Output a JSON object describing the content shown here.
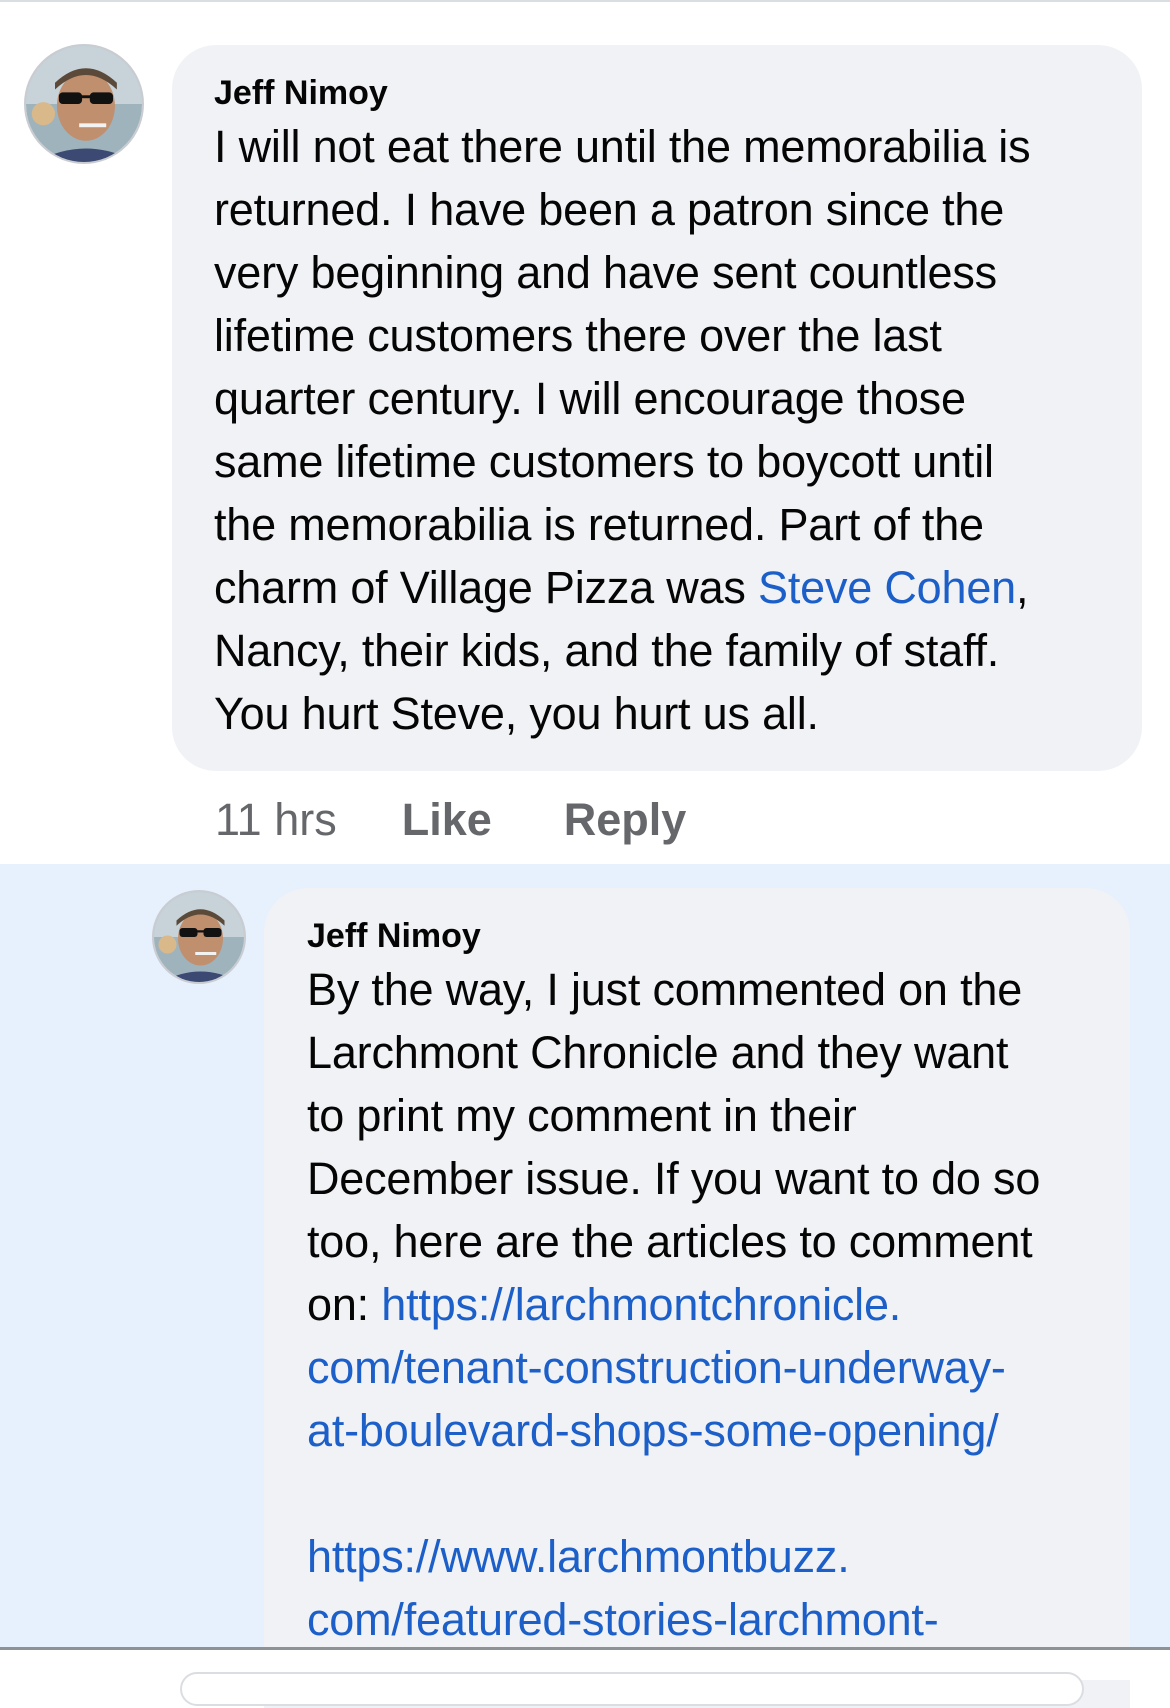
{
  "comment": {
    "author": "Jeff Nimoy",
    "lines": [
      "I will not eat there until the memorabilia is",
      "returned. I have been a patron since the",
      "very beginning and have sent countless",
      "lifetime customers there over the last",
      "quarter century. I will encourage those",
      "same lifetime customers to boycott until",
      "the memorabilia is returned. Part of the"
    ],
    "mention_line_before": "charm of Village Pizza was ",
    "mention": "Steve Cohen",
    "mention_line_after": ",",
    "tail_lines": [
      "Nancy, their kids, and the family of staff.",
      "You hurt Steve, you hurt us all."
    ],
    "time": "11 hrs",
    "like_label": "Like",
    "reply_label": "Reply"
  },
  "reply": {
    "author": "Jeff Nimoy",
    "lines": [
      "By the way, I just commented on  the",
      "Larchmont Chronicle and they want",
      "to print my comment in their",
      "December issue. If you want to do so",
      "too, here are the articles to comment"
    ],
    "link_prefix": "on: ",
    "link1_lines": [
      "https://larchmontchronicle.",
      "com/tenant-construction-underway-",
      "at-boulevard-shops-some-opening/"
    ],
    "link2_lines": [
      "https://www.larchmontbuzz.",
      "com/featured-stories-larchmont-"
    ]
  },
  "colors": {
    "bubble": "#f0f2f5",
    "link": "#1c5fc9",
    "reply_highlight": "#e7f0fd",
    "meta_text": "#65676b"
  },
  "icons": {
    "avatar": "profile-photo-sunglasses"
  }
}
